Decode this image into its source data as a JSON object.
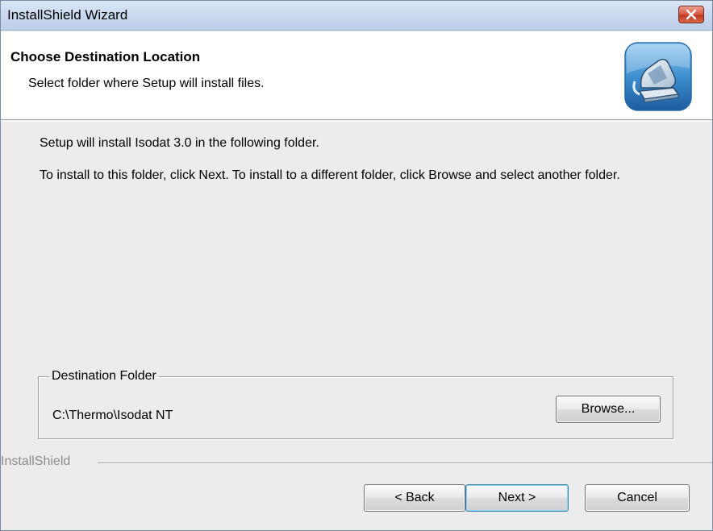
{
  "window": {
    "title": "InstallShield Wizard"
  },
  "header": {
    "title": "Choose Destination Location",
    "subtitle": "Select folder where Setup will install files.",
    "icon": "setup-computer-icon"
  },
  "body": {
    "line1": "Setup will install Isodat 3.0 in the following folder.",
    "line2": "To install to this folder, click Next. To install to a different folder, click Browse and select another folder."
  },
  "destination": {
    "legend": "Destination Folder",
    "path": "C:\\Thermo\\Isodat NT",
    "browse_label": "Browse..."
  },
  "footer": {
    "brand": "InstallShield",
    "back_label": "< Back",
    "next_label": "Next >",
    "cancel_label": "Cancel"
  },
  "colors": {
    "titlebar": "#c9d9ef",
    "close_button": "#d6553f",
    "dialog_bg": "#ececec",
    "default_button_border": "#3c7fb1"
  }
}
